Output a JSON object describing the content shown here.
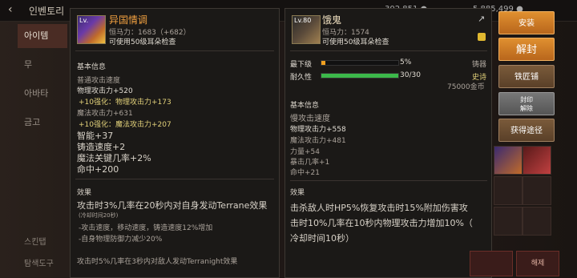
{
  "topbar": {
    "nav": "인벤토리",
    "gold": "302,851 ●",
    "cash": "5,885,499 ●"
  },
  "leftnav": {
    "items": [
      "아이템",
      "무",
      "아바타",
      "금고"
    ]
  },
  "bottomleft": [
    "스킨탭",
    "탐색도구"
  ],
  "left_item": {
    "level": "Lv.",
    "name": "异国情调",
    "power": "恒马力：1683（+682）",
    "note": "可使用50级耳朵检查",
    "section_basic": "基本信息",
    "lines": [
      "普通攻击速度",
      "物理攻击力+520",
      "+10强化：物理攻击力+173",
      "魔法攻击力+631",
      "+10强化：魔法攻击力+207",
      "智能+37",
      "铸造速度+2",
      "魔法关键几率+2%",
      "命中+200"
    ],
    "section_effect": "效果",
    "effect_lines": [
      "攻击时3%几率在20秒内对自身发动Terrane效果",
      "(冷却时间20秒)",
      "-攻击速度，移动速度，铸造速度12%增加",
      "-自身物理防御力减少20%",
      "攻击时5%几率在3秒内对敌人发动Terranight效果"
    ]
  },
  "right_item": {
    "level": "Lv.80",
    "name": "饿鬼",
    "power": "恒马力：1574",
    "note": "可使用50级耳朵检查",
    "grade_label": "最下级",
    "grade_value": "5%",
    "grade_type": "铸器",
    "durability_label": "耐久性",
    "durability_value": "30/30",
    "durability_type": "史诗",
    "price": "75000金币",
    "grade_fraction": 0.05,
    "durability_fraction": 1.0,
    "section_basic": "基本信息",
    "lines": [
      "慢攻击速度",
      "物理攻击力+558",
      "魔法攻击力+481",
      "力量+54",
      "暴击几率+1",
      "命中+21"
    ],
    "section_effect": "效果",
    "effect_lines": [
      "击杀敌人时HP5%恢复攻击时15%附加伤害攻",
      "击时10%几率在10秒内物理攻击力增加10%（",
      "冷却时间10秒）"
    ]
  },
  "buttons": {
    "install": "安装",
    "unseal": "解封",
    "smith": "铁匠铺",
    "seal": "封印\n解除",
    "acquire": "获得途径"
  },
  "side_buttons": [
    "",
    "해제"
  ],
  "colors": {
    "orange": "#e09030",
    "title_orange": "#f0a040",
    "yellow": "#e2d17a",
    "bar_orange": "#f0a020",
    "bar_green": "#3cb84a"
  }
}
